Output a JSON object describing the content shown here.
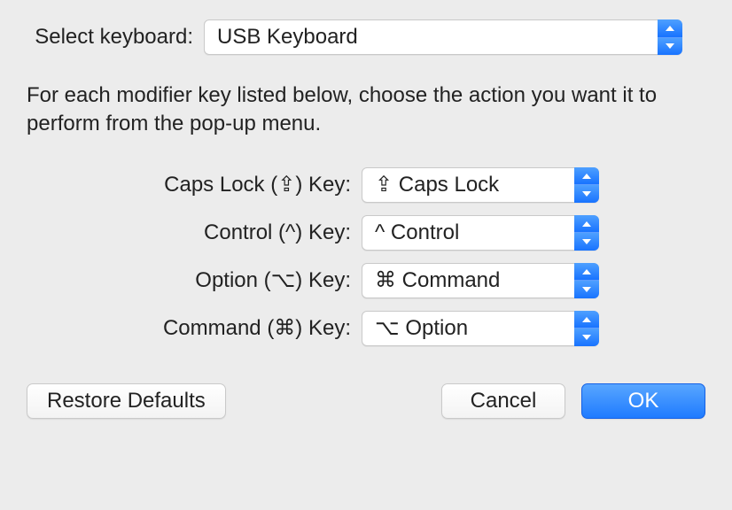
{
  "top": {
    "label": "Select keyboard:",
    "value": "USB Keyboard"
  },
  "instruction": "For each modifier key listed below, choose the action you want it to perform from the pop-up menu.",
  "modifiers": {
    "caps": {
      "label": "Caps Lock (⇪) Key:",
      "value": "⇪ Caps Lock"
    },
    "control": {
      "label": "Control (^) Key:",
      "value": "^ Control"
    },
    "option": {
      "label": "Option (⌥) Key:",
      "value": "⌘ Command"
    },
    "command": {
      "label": "Command (⌘) Key:",
      "value": "⌥ Option"
    }
  },
  "buttons": {
    "restore": "Restore Defaults",
    "cancel": "Cancel",
    "ok": "OK"
  }
}
